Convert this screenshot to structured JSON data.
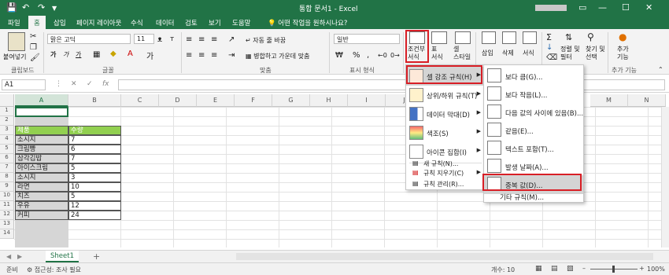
{
  "window": {
    "title": "통합 문서1 - Excel",
    "undo_icon": "undo-icon",
    "redo_icon": "redo-icon",
    "save_icon": "save-icon"
  },
  "tabs": [
    "파일",
    "홈",
    "삽입",
    "페이지 레이아웃",
    "수식",
    "데이터",
    "검토",
    "보기",
    "도움말"
  ],
  "active_tab": "홈",
  "tell_me": "어떤 작업을 원하시나요?",
  "ribbon": {
    "clipboard": {
      "paste": "붙여넣기",
      "group": "클립보드"
    },
    "font": {
      "name": "맑은 고딕",
      "size": "11",
      "bold": "가",
      "italic": "가",
      "underline": "가",
      "group": "글꼴"
    },
    "align": {
      "wrap": "자동 줄 바꿈",
      "merge": "병합하고 가운데 맞춤",
      "group": "맞춤"
    },
    "number": {
      "format": "일반",
      "percent": "%",
      "group": "표시 형식"
    },
    "styles": {
      "cond_format": "조건부\n서식",
      "table": "표\n서식",
      "cell_style": "셀\n스타일"
    },
    "cells": {
      "insert": "삽입",
      "delete": "삭제",
      "format": "서식"
    },
    "editing": {
      "sort": "정렬 및\n필터",
      "find": "찾기 및\n선택"
    },
    "addins": {
      "label": "추가\n기능",
      "group": "추가 기능"
    }
  },
  "formula_bar": {
    "name_box": "A1",
    "fx": "fx"
  },
  "columns": [
    "A",
    "B",
    "C",
    "D",
    "E",
    "F",
    "G",
    "H",
    "I",
    "J",
    "K",
    "L",
    "M",
    "N"
  ],
  "rows": [
    "1",
    "2",
    "3",
    "4",
    "5",
    "6",
    "7",
    "8",
    "9",
    "10",
    "11",
    "12",
    "13",
    "14"
  ],
  "table": {
    "headers": [
      "제품",
      "수량"
    ],
    "rows": [
      [
        "소시지",
        "7"
      ],
      [
        "크림빵",
        "6"
      ],
      [
        "삼각김밥",
        "7"
      ],
      [
        "아이스크림",
        "5"
      ],
      [
        "소시지",
        "3"
      ],
      [
        "라면",
        "10"
      ],
      [
        "치즈",
        "5"
      ],
      [
        "우유",
        "12"
      ],
      [
        "커피",
        "24"
      ]
    ]
  },
  "cf_menu": [
    {
      "label": "셀 강조 규칙(H)",
      "icon": "highlight-rules-icon",
      "submenu": true
    },
    {
      "label": "상위/하위 규칙(T)",
      "icon": "top-bottom-icon",
      "submenu": true
    },
    {
      "label": "데이터 막대(D)",
      "icon": "data-bar-icon",
      "submenu": true
    },
    {
      "label": "색조(S)",
      "icon": "color-scale-icon",
      "submenu": true
    },
    {
      "label": "아이콘 집합(I)",
      "icon": "icon-set-icon",
      "submenu": true
    }
  ],
  "cf_menu_small": [
    {
      "label": "새 규칙(N)...",
      "icon": "new-rule-icon"
    },
    {
      "label": "규칙 지우기(C)",
      "icon": "clear-rules-icon"
    },
    {
      "label": "규칙 관리(R)...",
      "icon": "manage-rules-icon"
    }
  ],
  "submenu": [
    {
      "label": "보다 큼(G)...",
      "icon": "greater-than-icon"
    },
    {
      "label": "보다 작음(L)...",
      "icon": "less-than-icon"
    },
    {
      "label": "다음 값의 사이에 있음(B)...",
      "icon": "between-icon"
    },
    {
      "label": "같음(E)...",
      "icon": "equal-to-icon"
    },
    {
      "label": "텍스트 포함(T)...",
      "icon": "text-contains-icon"
    },
    {
      "label": "발생 날짜(A)...",
      "icon": "date-occurring-icon"
    },
    {
      "label": "중복 값(D)...",
      "icon": "duplicate-values-icon"
    }
  ],
  "submenu_more": "기타 규칙(M)...",
  "sheet": {
    "name": "Sheet1",
    "add": "+"
  },
  "status": {
    "ready": "준비",
    "accessibility": "접근성: 조사 필요",
    "count": "개수: 10",
    "zoom": "100%"
  },
  "colors": {
    "excel_green": "#217346",
    "header_green": "#92d050",
    "highlight_red": "#d81f26"
  }
}
